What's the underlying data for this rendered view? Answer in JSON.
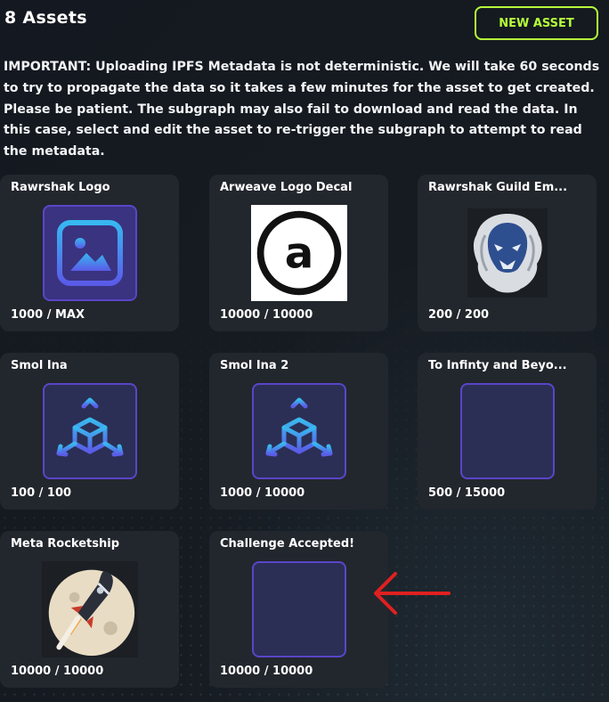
{
  "header": {
    "title": "8 Assets",
    "new_asset_label": "NEW ASSET"
  },
  "notice": "IMPORTANT: Uploading IPFS Metadata is not deterministic. We will take 60 seconds to try to propagate the data so it takes a few minutes for the asset to get created. Please be patient. The subgraph may also fail to download and read the data. In this case, select and edit the asset to re-trigger the subgraph to attempt to read the metadata.",
  "assets": [
    {
      "name": "Rawrshak Logo",
      "supply": "1000 / MAX",
      "thumbnail": "image-icon"
    },
    {
      "name": "Arweave Logo Decal",
      "supply": "10000 / 10000",
      "thumbnail": "arweave-logo-image"
    },
    {
      "name": "Rawrshak Guild Em...",
      "supply": "200 / 200",
      "thumbnail": "lion-emblem-image"
    },
    {
      "name": "Smol Ina",
      "supply": "100 / 100",
      "thumbnail": "3d-model-icon"
    },
    {
      "name": "Smol Ina 2",
      "supply": "1000 / 10000",
      "thumbnail": "3d-model-icon"
    },
    {
      "name": "To Infinty and Beyo...",
      "supply": "500 / 15000",
      "thumbnail": "audio-wave-icon"
    },
    {
      "name": "Meta Rocketship",
      "supply": "10000 / 10000",
      "thumbnail": "rocket-image"
    },
    {
      "name": "Challenge Accepted!",
      "supply": "10000 / 10000",
      "thumbnail": "audio-wave-icon"
    }
  ],
  "colors": {
    "accent": "#b5ff39",
    "card_bg": "#22272d",
    "icon_border": "#5a45c9",
    "annotation_arrow": "#e02020"
  }
}
